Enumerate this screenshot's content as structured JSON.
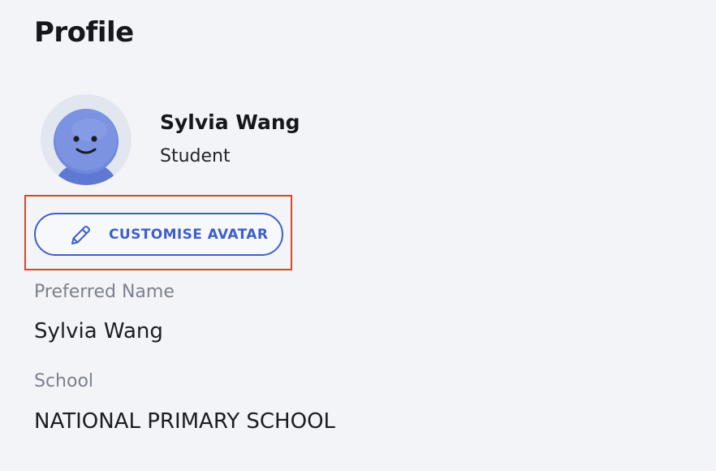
{
  "page": {
    "title": "Profile"
  },
  "user": {
    "name": "Sylvia Wang",
    "role": "Student",
    "avatar_icon": "smiley-avatar-icon"
  },
  "actions": {
    "customise_avatar_label": "CUSTOMISE AVATAR",
    "customise_avatar_icon": "pencil-icon"
  },
  "fields": {
    "preferred_name": {
      "label": "Preferred Name",
      "value": "Sylvia Wang"
    },
    "school": {
      "label": "School",
      "value": "NATIONAL PRIMARY SCHOOL"
    }
  },
  "colors": {
    "accent": "#3f5fc6",
    "highlight": "#d9462e",
    "background": "#f3f4f8",
    "label": "#7c818d"
  }
}
